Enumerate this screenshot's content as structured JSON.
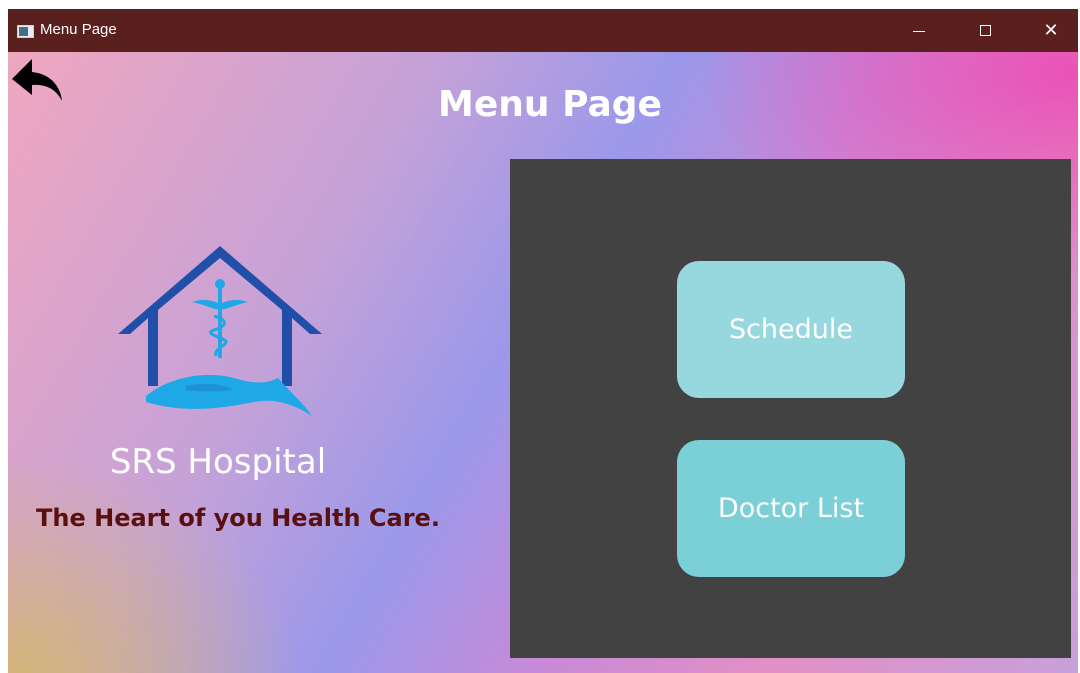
{
  "window": {
    "title": "Menu Page",
    "controls": {
      "minimize": "minimize-icon",
      "maximize": "maximize-icon",
      "close": "close-icon"
    }
  },
  "header": {
    "title": "Menu Page",
    "back_icon": "back-arrow-icon"
  },
  "branding": {
    "logo_icon": "hospital-house-caduceus-logo",
    "name": "SRS Hospital",
    "tagline": "The Heart of you Health Care."
  },
  "menu": {
    "schedule_label": "Schedule",
    "doctor_list_label": "Doctor List"
  },
  "colors": {
    "titlebar": "#5a201d",
    "panel": "#424242",
    "schedule_button": "#97d8df",
    "doctor_button": "#7bd0d7",
    "tagline": "#5a1010",
    "logo_blue": "#1f4fa8",
    "logo_cyan": "#1fa8e6"
  }
}
